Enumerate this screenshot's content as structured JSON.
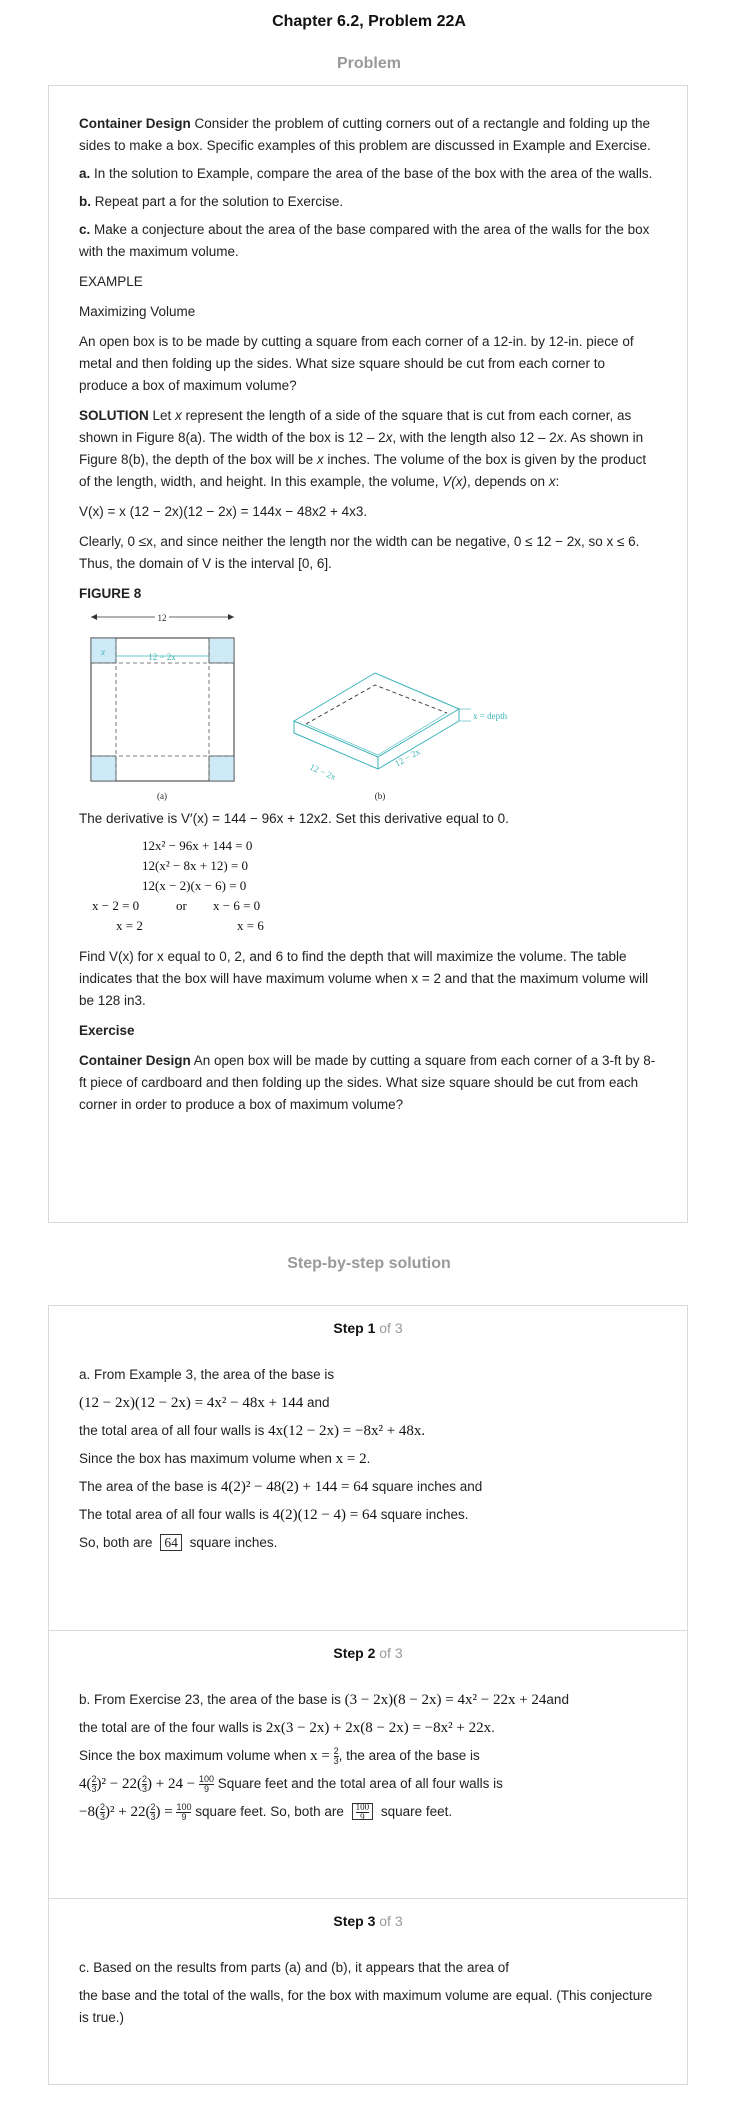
{
  "page": {
    "title": "Chapter 6.2, Problem 22A",
    "problem_heading": "Problem",
    "solution_heading": "Step-by-step solution"
  },
  "problem": {
    "intro_bold": "Container Design",
    "intro_text": " Consider the problem of cutting corners out of a rectangle and folding up the sides to make a box. Specific examples of this problem are discussed in Example and Exercise.",
    "part_a_label": "a.",
    "part_a_text": " In the solution to Example, compare the area of the base of the box with the area of the walls.",
    "part_b_label": "b.",
    "part_b_text": " Repeat part a for the solution to Exercise.",
    "part_c_label": "c.",
    "part_c_text": " Make a conjecture about the area of the base compared with the area of the walls for the box with the maximum volume.",
    "example_label": "EXAMPLE",
    "example_title": "Maximizing Volume",
    "example_text": "An open box is to be made by cutting a square from each corner of a 12-in. by 12-in. piece of metal and then folding up the sides. What size square should be cut from each corner to produce a box of maximum volume?",
    "solution_bold": "SOLUTION",
    "solution_text_1": " Let ",
    "solution_text_2": " represent the length of a side of the square that is cut from each corner, as shown in Figure 8(a). The width of the box is 12 – 2",
    "solution_text_3": ", with the length also 12 – 2",
    "solution_text_4": ". As shown in Figure 8(b), the depth of the box will be ",
    "solution_text_5": " inches. The volume of the box is given by the product of the length, width, and height. In this example, the volume, ",
    "solution_text_6": ", depends on ",
    "solution_text_7": ":",
    "var_x": "x",
    "volume_fn": "V(x)",
    "volume_eq": "V(x) = x (12 − 2x)(12 − 2x) = 144x − 48x2 + 4x3.",
    "domain_text": "Clearly, 0 ≤x, and since neither the length nor the width can be negative, 0 ≤ 12 − 2x, so x ≤ 6. Thus, the domain of V is the interval [0, 6].",
    "figure_label": "FIGURE 8",
    "figure": {
      "top_dim": "12",
      "inner_dim": "12 − 2x",
      "corner_label": "x",
      "depth_label": "x = depth",
      "side_label_1": "12 − 2x",
      "side_label_2": "12 − 2x",
      "caption_a": "(a)",
      "caption_b": "(b)"
    },
    "derivative_text": "The derivative is V′(x) = 144 − 96x + 12x2. Set this derivative equal to 0.",
    "equations": {
      "eq1": "12x² − 96x + 144 = 0",
      "eq2": "12(x² − 8x + 12) = 0",
      "eq3": "12(x − 2)(x − 6) = 0",
      "eq4_left": "x − 2 = 0",
      "eq4_or": "or",
      "eq4_right": "x − 6 = 0",
      "eq5_left": "x = 2",
      "eq5_right": "x = 6"
    },
    "find_text": "Find V(x) for x equal to 0, 2, and 6 to find the depth that will maximize the volume. The table indicates that the box will have maximum volume when x = 2 and that the maximum volume will be 128 in3.",
    "exercise_label": "Exercise",
    "exercise_bold": "Container Design",
    "exercise_text": " An open box will be made by cutting a square from each corner of a 3-ft by 8-ft piece of cardboard and then folding up the sides. What size square should be cut from each corner in order to produce a box of maximum volume?"
  },
  "steps": [
    {
      "label": "Step 1",
      "of": " of 3",
      "line1": "a. From Example 3, the area of the base is",
      "line2_math": "(12 − 2x)(12 − 2x) = 4x² − 48x + 144",
      "line2_text": " and",
      "line3_text": "the total area of all four walls is ",
      "line3_math": "4x(12 − 2x) = −8x² + 48x.",
      "line4_text": "Since the box has maximum volume when ",
      "line4_math": "x = 2",
      "line4_end": ".",
      "line5_text": "The area of the base is ",
      "line5_math": "4(2)² − 48(2) + 144 = 64",
      "line5_end": " square inches and",
      "line6_text": "The total area of all four walls is ",
      "line6_math": "4(2)(12 − 4) = 64",
      "line6_end": " square inches.",
      "line7_text": "So, both are ",
      "line7_box": "64",
      "line7_end": " square inches."
    },
    {
      "label": "Step 2",
      "of": " of 3",
      "line1_text": "b. From Exercise 23, the area of the base is ",
      "line1_math": "(3 − 2x)(8 − 2x) = 4x² − 22x + 24",
      "line1_end": "and",
      "line2_text": "the total are of the four walls is ",
      "line2_math": "2x(3 − 2x) + 2x(8 − 2x) = −8x² + 22x",
      "line2_end": ".",
      "line3_text": "Since the box maximum volume when ",
      "line3_math": "x =",
      "frac_2_3_num": "2",
      "frac_2_3_den": "3",
      "line3_end": ", the area of the base is",
      "line4_math_a": "4",
      "line4_math_b": "² − 22",
      "line4_math_c": " + 24 −",
      "frac_100_9_num": "100",
      "frac_100_9_den": "9",
      "line4_end": " Square feet and the total area of all four walls is",
      "line5_math_a": "−8",
      "line5_math_b": "² + 22",
      "line5_math_c": " =",
      "line5_end": " square feet. So, both are ",
      "line5_tail": " square feet."
    },
    {
      "label": "Step 3",
      "of": " of 3",
      "line1": "c. Based on the results from parts (a) and (b), it appears that the area of",
      "line2": "the base and the total of the walls, for the box with maximum volume are equal. (This conjecture is true.)"
    }
  ],
  "colors": {
    "heading_gray": "#999999",
    "card_border": "#d9d9d9",
    "figure_fill": "#cdeaf6",
    "figure_teal": "#3bb3b8"
  }
}
